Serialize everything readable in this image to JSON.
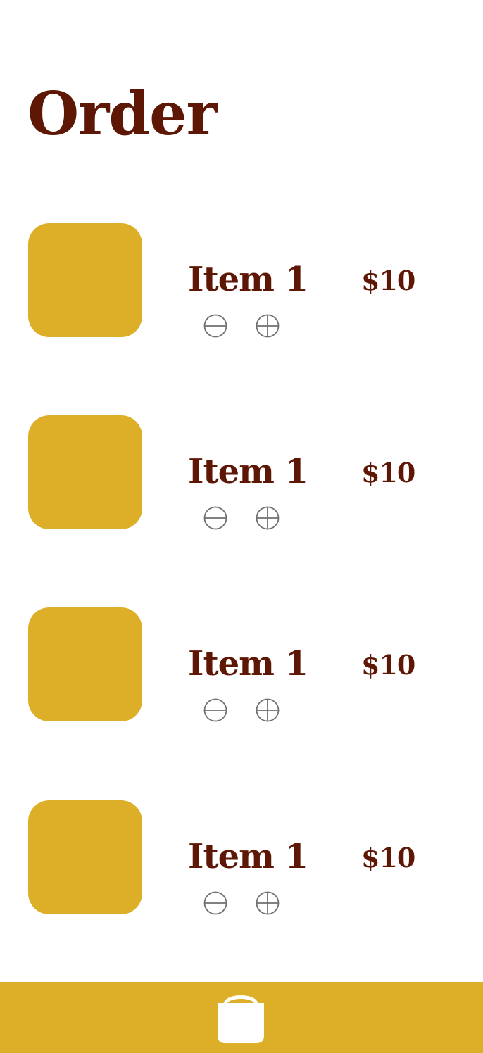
{
  "header": {
    "title": "Order"
  },
  "items": [
    {
      "name": "Item 1",
      "price": "$10",
      "thumb_color": "#ddae28",
      "minus_icon": "circle-minus-icon",
      "plus_icon": "circle-plus-icon"
    },
    {
      "name": "Item 1",
      "price": "$10",
      "thumb_color": "#ddae28",
      "minus_icon": "circle-minus-icon",
      "plus_icon": "circle-plus-icon"
    },
    {
      "name": "Item 1",
      "price": "$10",
      "thumb_color": "#ddae28",
      "minus_icon": "circle-minus-icon",
      "plus_icon": "circle-plus-icon"
    },
    {
      "name": "Item 1",
      "price": "$10",
      "thumb_color": "#ddae28",
      "minus_icon": "circle-minus-icon",
      "plus_icon": "circle-plus-icon"
    }
  ],
  "bottom_bar": {
    "icon": "shopping-bag-icon",
    "background": "#ddae28"
  },
  "colors": {
    "accent": "#ddae28",
    "text": "#5e1705",
    "icon_stroke": "#6f6f6f",
    "background": "#ffffff"
  }
}
